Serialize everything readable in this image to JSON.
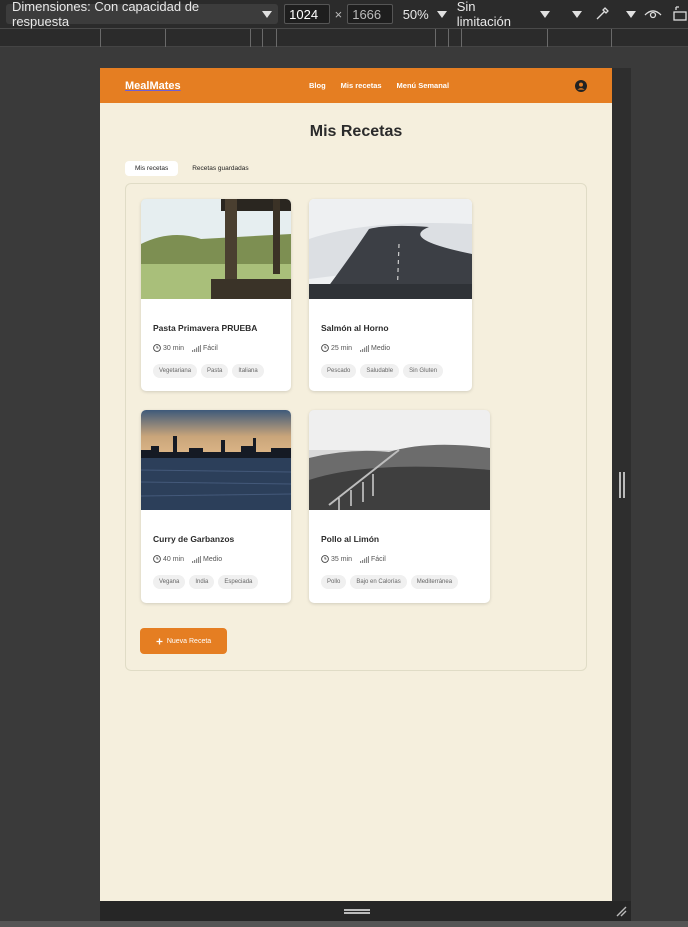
{
  "devtools": {
    "dimensions_label": "Dimensiones: Con capacidad de respuesta",
    "width_value": "1024",
    "times": "×",
    "height_value": "1666",
    "zoom": "50%",
    "throttle": "Sin limitación"
  },
  "nav": {
    "logo": "MealMates",
    "links": [
      "Blog",
      "Mis recetas",
      "Menú Semanal"
    ]
  },
  "page": {
    "title": "Mis Recetas",
    "tabs": [
      "Mis recetas",
      "Recetas guardadas"
    ]
  },
  "recipes": [
    {
      "title": "Pasta Primavera PRUEBA",
      "time": "30 min",
      "difficulty": "Fácil",
      "tags": [
        "Vegetariana",
        "Pasta",
        "Italiana"
      ]
    },
    {
      "title": "Salmón al Horno",
      "time": "25 min",
      "difficulty": "Medio",
      "tags": [
        "Pescado",
        "Saludable",
        "Sin Gluten"
      ]
    },
    {
      "title": "Curry de Garbanzos",
      "time": "40 min",
      "difficulty": "Medio",
      "tags": [
        "Vegana",
        "India",
        "Especiada"
      ]
    },
    {
      "title": "Pollo al Limón",
      "time": "35 min",
      "difficulty": "Fácil",
      "tags": [
        "Pollo",
        "Bajo en Calorías",
        "Mediterránea"
      ]
    }
  ],
  "new_recipe_button": "Nueva Receta",
  "colors": {
    "accent": "#e57e22",
    "page_bg": "#f5efdd"
  }
}
